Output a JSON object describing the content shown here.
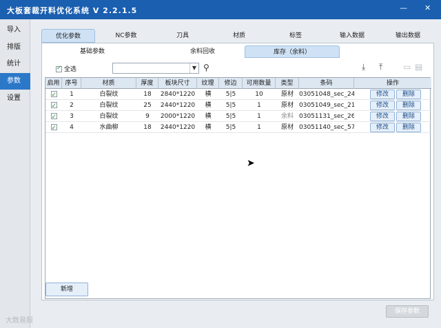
{
  "app": {
    "title": "大板套裁开料优化系统 V 2.2.1.5"
  },
  "sidebar": {
    "items": [
      "导入",
      "排版",
      "统计",
      "参数",
      "设置"
    ],
    "active": "参数"
  },
  "tabs": [
    "优化参数",
    "NC参数",
    "刀具",
    "材质",
    "标签",
    "输入数据",
    "输出数据"
  ],
  "subtabs": [
    "基础参数",
    "余料回收",
    "库存（余料）"
  ],
  "toolbar": {
    "select_all": "全选",
    "dropdown_value": ""
  },
  "table": {
    "headers": [
      "启用",
      "序号",
      "材质",
      "厚度",
      "板块尺寸",
      "纹理",
      "修边",
      "可用数量",
      "类型",
      "条码",
      "操作"
    ],
    "rows": [
      {
        "enabled": true,
        "no": "1",
        "material": "白裂纹",
        "thickness": "18",
        "size": "2840*1220",
        "grain": "横",
        "trim": "5|5",
        "qty": "10",
        "type": "原材",
        "barcode": "03051048_sec_24"
      },
      {
        "enabled": true,
        "no": "2",
        "material": "白裂纹",
        "thickness": "25",
        "size": "2440*1220",
        "grain": "横",
        "trim": "5|5",
        "qty": "1",
        "type": "原材",
        "barcode": "03051049_sec_21"
      },
      {
        "enabled": true,
        "no": "3",
        "material": "白裂纹",
        "thickness": "9",
        "size": "2000*1220",
        "grain": "横",
        "trim": "5|5",
        "qty": "1",
        "type": "余料",
        "barcode": "03051131_sec_26"
      },
      {
        "enabled": true,
        "no": "4",
        "material": "水曲柳",
        "thickness": "18",
        "size": "2440*1220",
        "grain": "横",
        "trim": "5|5",
        "qty": "1",
        "type": "原材",
        "barcode": "03051140_sec_57"
      }
    ],
    "edit_label": "修改",
    "delete_label": "删除"
  },
  "buttons": {
    "add": "新增",
    "save": "保存参数"
  },
  "watermark": "大数易服",
  "icons": [
    "search-icon",
    "import-icon",
    "export-icon",
    "copy-icon",
    "print-icon"
  ]
}
